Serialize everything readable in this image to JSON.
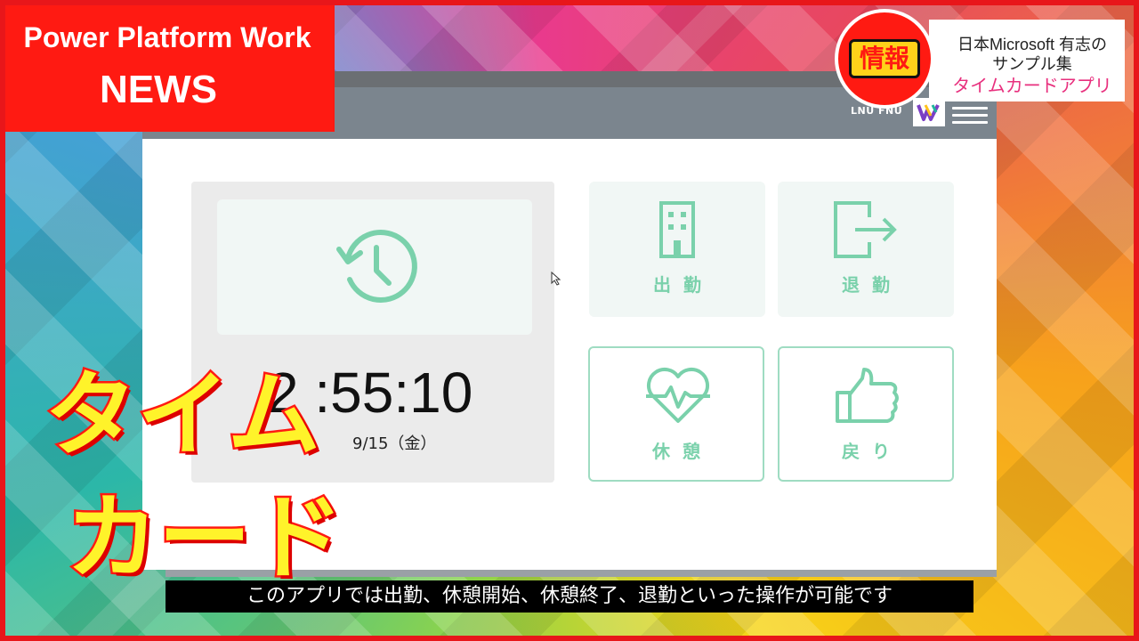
{
  "banner": {
    "line1": "Power Platform Work",
    "line2": "NEWS"
  },
  "info": {
    "badge": "情報",
    "line1": "日本Microsoft 有志の",
    "line2": "サンプル集",
    "line3": "タイムカードアプリ"
  },
  "app": {
    "user_name": "LNU FNU",
    "time": "2 :55:10",
    "date": "9/15（金）",
    "actions": [
      {
        "label": "出勤"
      },
      {
        "label": "退勤"
      },
      {
        "label": "休憩"
      },
      {
        "label": "戻り"
      }
    ]
  },
  "overlay": {
    "title_line1": "タイム",
    "title_line2": "カード"
  },
  "subtitle": "このアプリでは出勤、休憩開始、休憩終了、退勤といった操作が可能です",
  "colors": {
    "accent_red": "#ff1a12",
    "accent_green": "#7ad1ab",
    "title_yellow": "#fff32a",
    "header_gray": "#7b858e"
  }
}
